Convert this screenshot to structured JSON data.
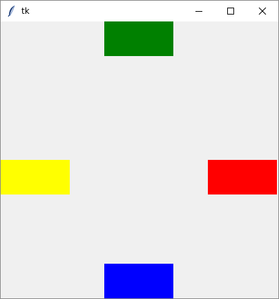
{
  "window": {
    "title": "tk",
    "icon": "feather-icon",
    "controls": {
      "minimize_icon": "minimize-icon",
      "maximize_icon": "maximize-icon",
      "close_icon": "close-icon"
    }
  },
  "canvas": {
    "background": "#f0f0f0",
    "blocks": [
      {
        "id": "top",
        "color": "#008000"
      },
      {
        "id": "left",
        "color": "#ffff00"
      },
      {
        "id": "right",
        "color": "#ff0000"
      },
      {
        "id": "bottom",
        "color": "#0000ff"
      }
    ]
  }
}
